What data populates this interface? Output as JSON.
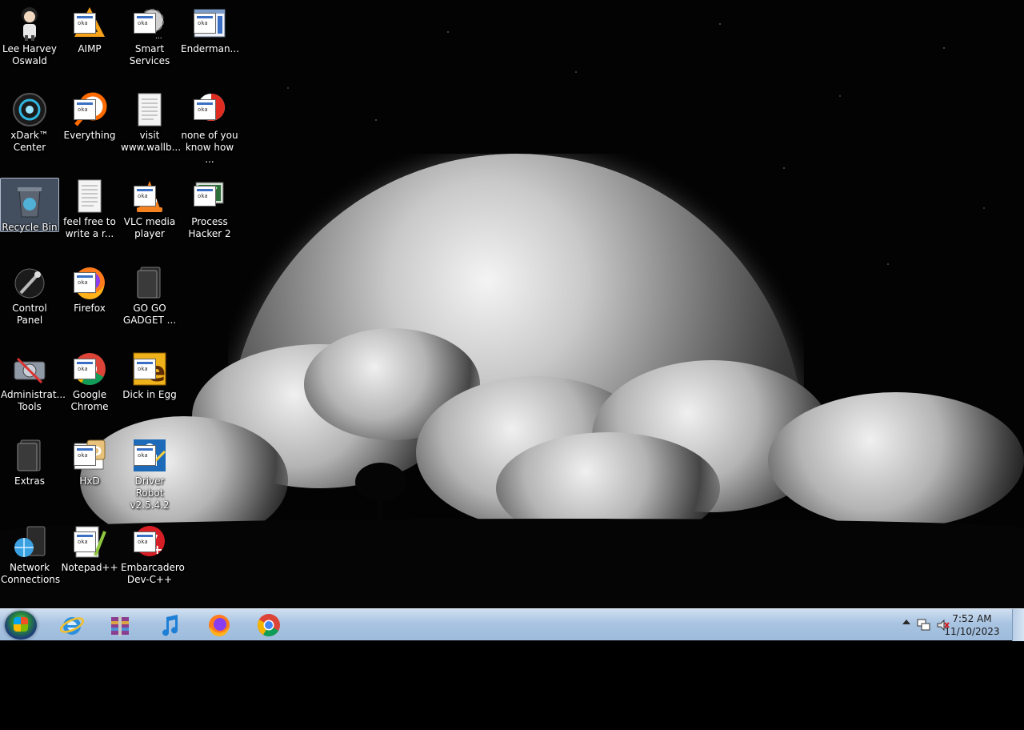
{
  "desktop": {
    "icons": [
      {
        "id": "lee-harvey-oswald",
        "label": "Lee Harvey Oswald",
        "icon": "character-icon",
        "col": 0,
        "row": 0
      },
      {
        "id": "aimp",
        "label": "AIMP",
        "icon": "aimp-icon",
        "col": 1,
        "row": 0
      },
      {
        "id": "smart-services",
        "label": "Smart Services",
        "icon": "gear-icon",
        "col": 2,
        "row": 0
      },
      {
        "id": "enderman",
        "label": "Enderman...",
        "icon": "window-icon",
        "col": 3,
        "row": 0
      },
      {
        "id": "xdark-center",
        "label": "xDark™ Center",
        "icon": "orb-icon",
        "col": 0,
        "row": 1
      },
      {
        "id": "everything",
        "label": "Everything",
        "icon": "search-icon",
        "col": 1,
        "row": 1
      },
      {
        "id": "visit-wallb",
        "label": "visit www.wallb...",
        "icon": "text-file-icon",
        "col": 2,
        "row": 1
      },
      {
        "id": "none-of-you",
        "label": "none of you know how ...",
        "icon": "red-circle-icon",
        "col": 3,
        "row": 1
      },
      {
        "id": "recycle-bin",
        "label": "Recycle Bin",
        "icon": "recycle-bin-icon",
        "col": 0,
        "row": 2,
        "selected": true
      },
      {
        "id": "feel-free",
        "label": "feel free to write a r...",
        "icon": "text-file-icon",
        "col": 1,
        "row": 2
      },
      {
        "id": "vlc",
        "label": "VLC media player",
        "icon": "vlc-cone-icon",
        "col": 2,
        "row": 2
      },
      {
        "id": "process-hacker",
        "label": "Process Hacker 2",
        "icon": "monitor-icon",
        "col": 3,
        "row": 2
      },
      {
        "id": "control-panel",
        "label": "Control Panel",
        "icon": "control-panel-icon",
        "col": 0,
        "row": 3
      },
      {
        "id": "firefox",
        "label": "Firefox",
        "icon": "firefox-icon",
        "col": 1,
        "row": 3
      },
      {
        "id": "go-go-gadget",
        "label": "GO GO GADGET ...",
        "icon": "dark-folder-icon",
        "col": 2,
        "row": 3
      },
      {
        "id": "admin-tools",
        "label": "Administrat... Tools",
        "icon": "tools-icon",
        "col": 0,
        "row": 4
      },
      {
        "id": "google-chrome",
        "label": "Google Chrome",
        "icon": "chrome-icon",
        "col": 1,
        "row": 4
      },
      {
        "id": "dick-in-egg",
        "label": "Dick in Egg",
        "icon": "egg-app-icon",
        "col": 2,
        "row": 4
      },
      {
        "id": "extras",
        "label": "Extras",
        "icon": "dark-folder-icon",
        "col": 0,
        "row": 5
      },
      {
        "id": "hxd",
        "label": "HxD",
        "icon": "hex-editor-icon",
        "col": 1,
        "row": 5
      },
      {
        "id": "driver-robot",
        "label": "Driver Robot v2.5.4.2",
        "icon": "driver-robot-icon",
        "col": 2,
        "row": 5
      },
      {
        "id": "network-connections",
        "label": "Network Connections",
        "icon": "network-icon",
        "col": 0,
        "row": 6
      },
      {
        "id": "notepad-pp",
        "label": "Notepad++",
        "icon": "notepad-icon",
        "col": 1,
        "row": 6
      },
      {
        "id": "embarcadero",
        "label": "Embarcadero Dev-C++",
        "icon": "devcpp-icon",
        "col": 2,
        "row": 6
      }
    ]
  },
  "taskbar": {
    "start_label": "Start",
    "pinned": [
      {
        "name": "internet-explorer",
        "icon": "ie-icon"
      },
      {
        "name": "archive-tool",
        "icon": "archive-icon"
      },
      {
        "name": "music-player",
        "icon": "music-note-icon"
      },
      {
        "name": "firefox",
        "icon": "firefox-icon"
      },
      {
        "name": "google-chrome",
        "icon": "chrome-icon"
      }
    ],
    "tray": {
      "time": "7:52 AM",
      "date": "11/10/2023"
    }
  },
  "colors": {
    "taskbar_top": "#cfdff0",
    "taskbar_bottom": "#9dbbdc",
    "selection": "#788caa"
  }
}
